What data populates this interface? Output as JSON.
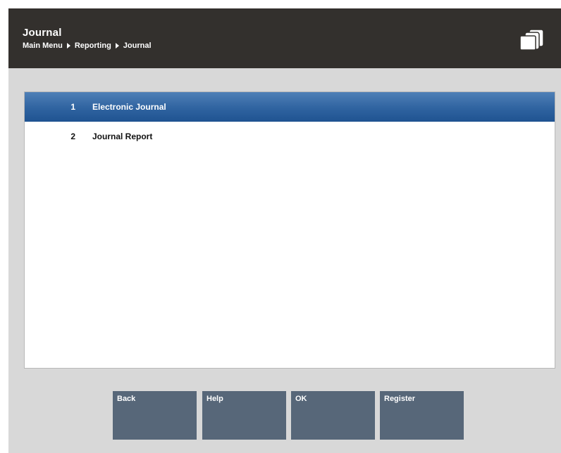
{
  "header": {
    "title": "Journal",
    "breadcrumb": [
      "Main Menu",
      "Reporting",
      "Journal"
    ],
    "icon": "register-device-icon"
  },
  "menu": {
    "items": [
      {
        "number": "1",
        "label": "Electronic Journal",
        "selected": true
      },
      {
        "number": "2",
        "label": "Journal Report",
        "selected": false
      }
    ]
  },
  "buttons": {
    "back": "Back",
    "help": "Help",
    "ok": "OK",
    "register": "Register"
  },
  "colors": {
    "header_bg": "#33302d",
    "selected_row": "#2f63a0",
    "button_bg": "#576779",
    "frame_bg": "#d8d8d8"
  }
}
